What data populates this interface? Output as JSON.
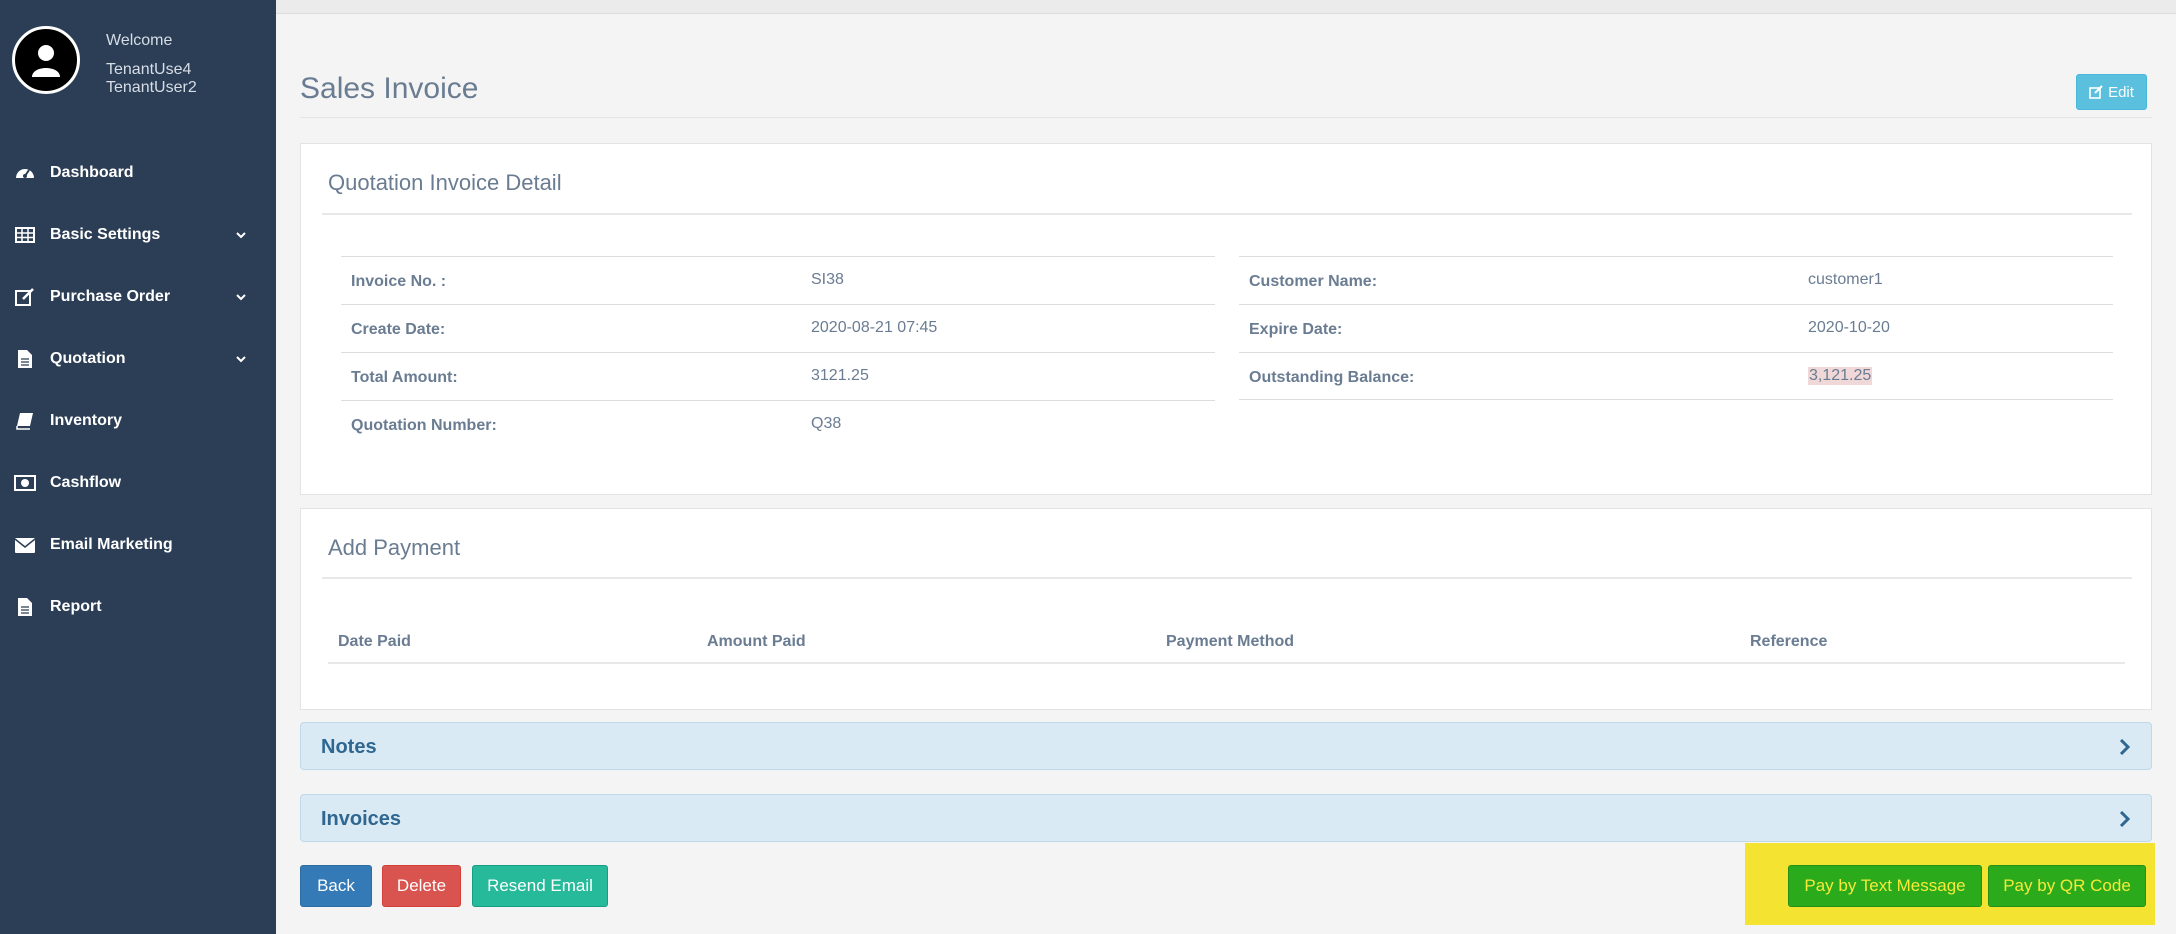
{
  "sidebar": {
    "welcome": "Welcome",
    "user_line1": "TenantUse4",
    "user_line2": "TenantUser2",
    "items": [
      {
        "label": "Dashboard",
        "icon": "dashboard-icon",
        "has_submenu": false
      },
      {
        "label": "Basic Settings",
        "icon": "table-icon",
        "has_submenu": true
      },
      {
        "label": "Purchase Order",
        "icon": "edit-icon",
        "has_submenu": true
      },
      {
        "label": "Quotation",
        "icon": "file-icon",
        "has_submenu": true
      },
      {
        "label": "Inventory",
        "icon": "book-icon",
        "has_submenu": false
      },
      {
        "label": "Cashflow",
        "icon": "money-icon",
        "has_submenu": false
      },
      {
        "label": "Email Marketing",
        "icon": "envelope-icon",
        "has_submenu": false
      },
      {
        "label": "Report",
        "icon": "file-icon",
        "has_submenu": false
      }
    ]
  },
  "header": {
    "title": "Sales Invoice",
    "edit_label": "Edit"
  },
  "detail": {
    "title": "Quotation Invoice Detail",
    "left": [
      {
        "label": "Invoice No. :",
        "value": "SI38"
      },
      {
        "label": "Create Date:",
        "value": "2020-08-21 07:45"
      },
      {
        "label": "Total Amount:",
        "value": "3121.25"
      },
      {
        "label": "Quotation Number:",
        "value": "Q38"
      }
    ],
    "right": [
      {
        "label": "Customer Name:",
        "value": "customer1"
      },
      {
        "label": "Expire Date:",
        "value": "2020-10-20"
      },
      {
        "label": "Outstanding Balance:",
        "value": "3,121.25"
      }
    ]
  },
  "payment": {
    "title": "Add Payment",
    "columns": [
      "Date Paid",
      "Amount Paid",
      "Payment Method",
      "Reference"
    ]
  },
  "sections": {
    "notes": "Notes",
    "invoices": "Invoices"
  },
  "actions": {
    "back": "Back",
    "delete": "Delete",
    "resend": "Resend Email",
    "pay_sms": "Pay by Text Message",
    "pay_qr": "Pay by QR Code"
  },
  "colors": {
    "sidebar_bg": "#2c3e55",
    "accent_info": "#5bc0de",
    "primary": "#337ab7",
    "danger": "#d9534f",
    "success": "#26b99a",
    "pay_green": "#2bab1c",
    "highlight_yellow": "#f5e332"
  }
}
